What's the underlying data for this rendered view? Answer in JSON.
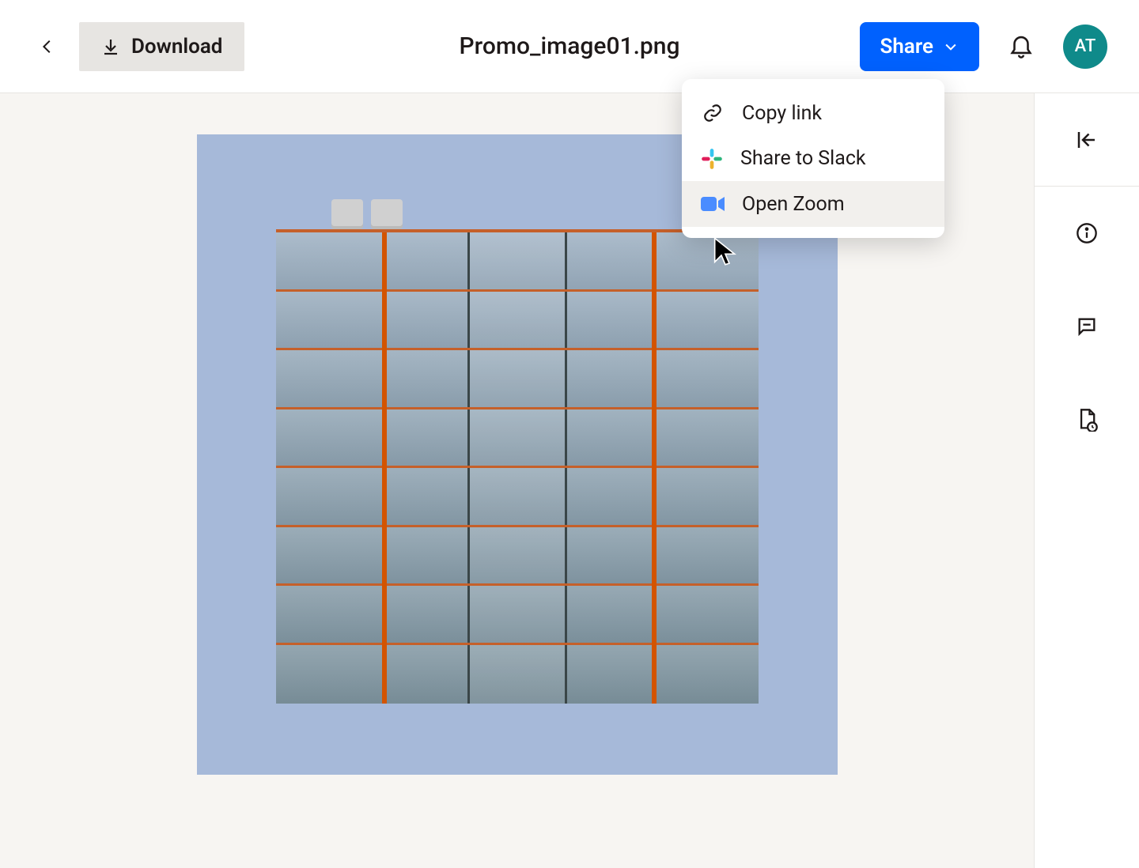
{
  "header": {
    "download_label": "Download",
    "file_title": "Promo_image01.png",
    "share_label": "Share",
    "avatar_initials": "AT"
  },
  "share_menu": {
    "items": [
      {
        "label": "Copy link",
        "icon": "link-icon"
      },
      {
        "label": "Share to Slack",
        "icon": "slack-icon"
      },
      {
        "label": "Open Zoom",
        "icon": "zoom-icon"
      }
    ],
    "hovered_index": 2
  },
  "colors": {
    "accent_blue": "#0061fe",
    "canvas_bg": "#f7f5f2",
    "avatar_bg": "#0f8a8a",
    "button_gray": "#e7e5e2"
  }
}
